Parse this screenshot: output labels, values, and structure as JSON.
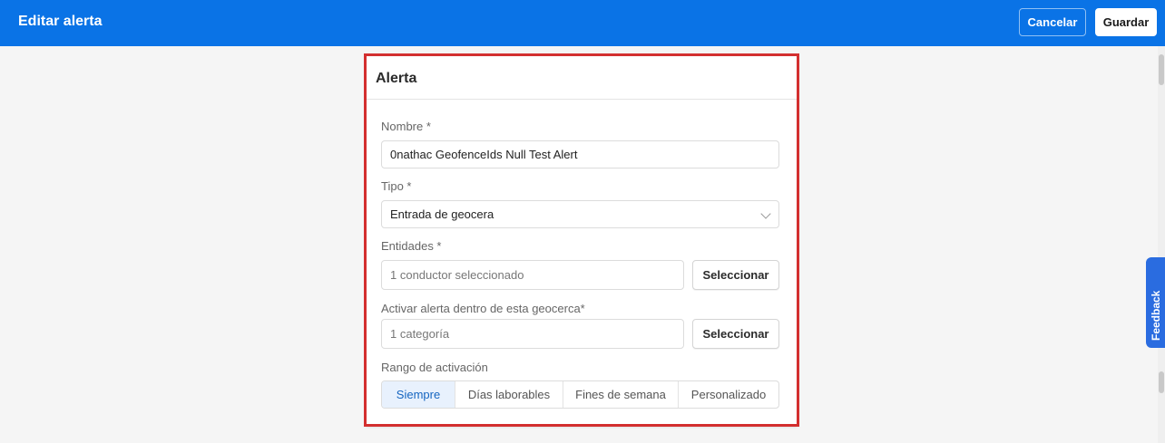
{
  "header": {
    "title": "Editar alerta",
    "cancel_label": "Cancelar",
    "save_label": "Guardar"
  },
  "card": {
    "title": "Alerta",
    "name": {
      "label": "Nombre *",
      "value": "0nathac GeofenceIds Null Test Alert"
    },
    "type": {
      "label": "Tipo *",
      "value": "Entrada de geocera"
    },
    "entities": {
      "label": "Entidades *",
      "value": "1 conductor seleccionado",
      "button": "Seleccionar"
    },
    "geofence": {
      "label": "Activar alerta dentro de esta geocerca*",
      "value": "1 categoría",
      "button": "Seleccionar"
    },
    "range": {
      "label": "Rango de activación",
      "options": [
        "Siempre",
        "Días laborables",
        "Fines de semana",
        "Personalizado"
      ],
      "selected": "Siempre"
    }
  },
  "feedback": {
    "label": "Feedback",
    "icon": "feedback-icon"
  },
  "colors": {
    "topbar": "#0a73e6",
    "highlight": "#d32f2f",
    "active_segment": "#e8f1fd"
  }
}
